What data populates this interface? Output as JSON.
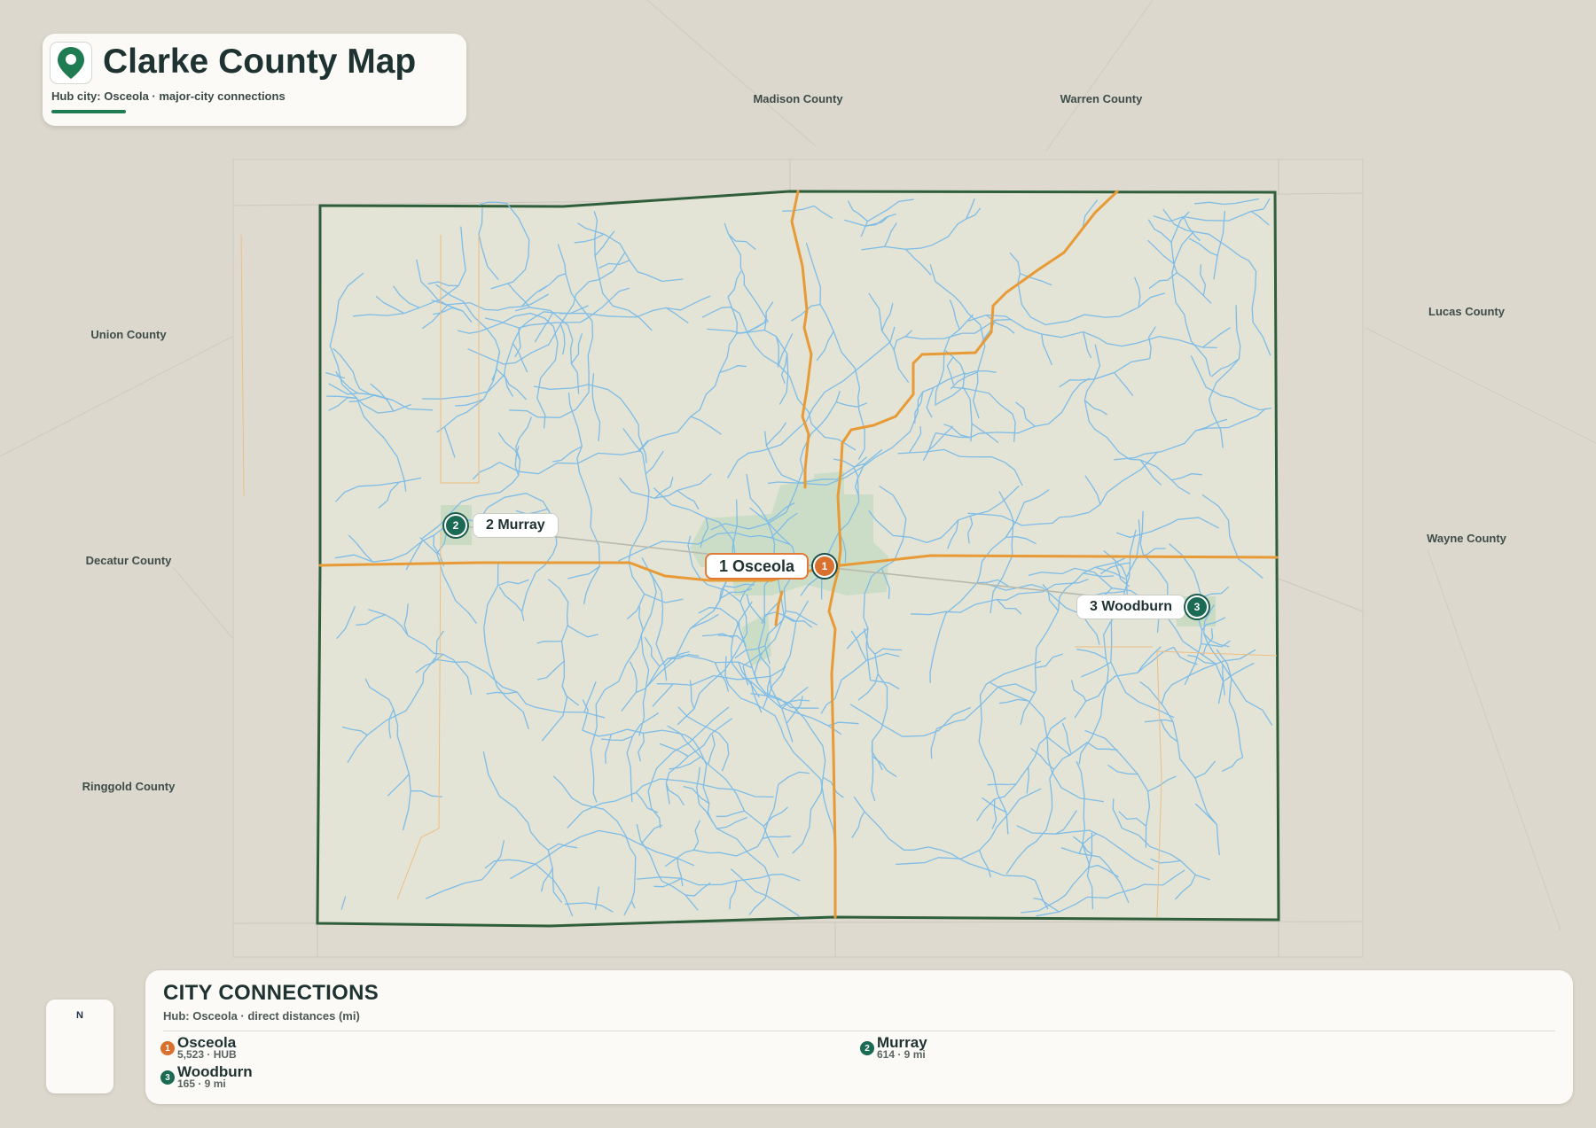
{
  "header": {
    "title": "Clarke County Map",
    "subtitle": "Hub city: Osceola · major-city connections"
  },
  "neighbors": {
    "madison": "Madison County",
    "warren": "Warren County",
    "union": "Union County",
    "lucas": "Lucas County",
    "decatur": "Decatur County",
    "wayne": "Wayne County",
    "ringgold": "Ringgold County"
  },
  "cities": {
    "osceola": {
      "badge": "1",
      "label": "1 Osceola",
      "name": "Osceola",
      "meta": "5,523 · HUB"
    },
    "murray": {
      "badge": "2",
      "label": "2 Murray",
      "name": "Murray",
      "meta": "614 · 9 mi"
    },
    "woodburn": {
      "badge": "3",
      "label": "3 Woodburn",
      "name": "Woodburn",
      "meta": "165 · 9 mi"
    }
  },
  "legend": {
    "title": "CITY CONNECTIONS",
    "subtitle": "Hub: Osceola · direct distances (mi)"
  },
  "compass": {
    "label": "N"
  },
  "colors": {
    "county_border": "#2f5e3a",
    "county_fill": "#e3e4d6",
    "river": "#79b9e6",
    "highway": "#e79a35",
    "hub": "#d9702e",
    "city": "#1b6b54",
    "background": "#dcd8cd"
  }
}
